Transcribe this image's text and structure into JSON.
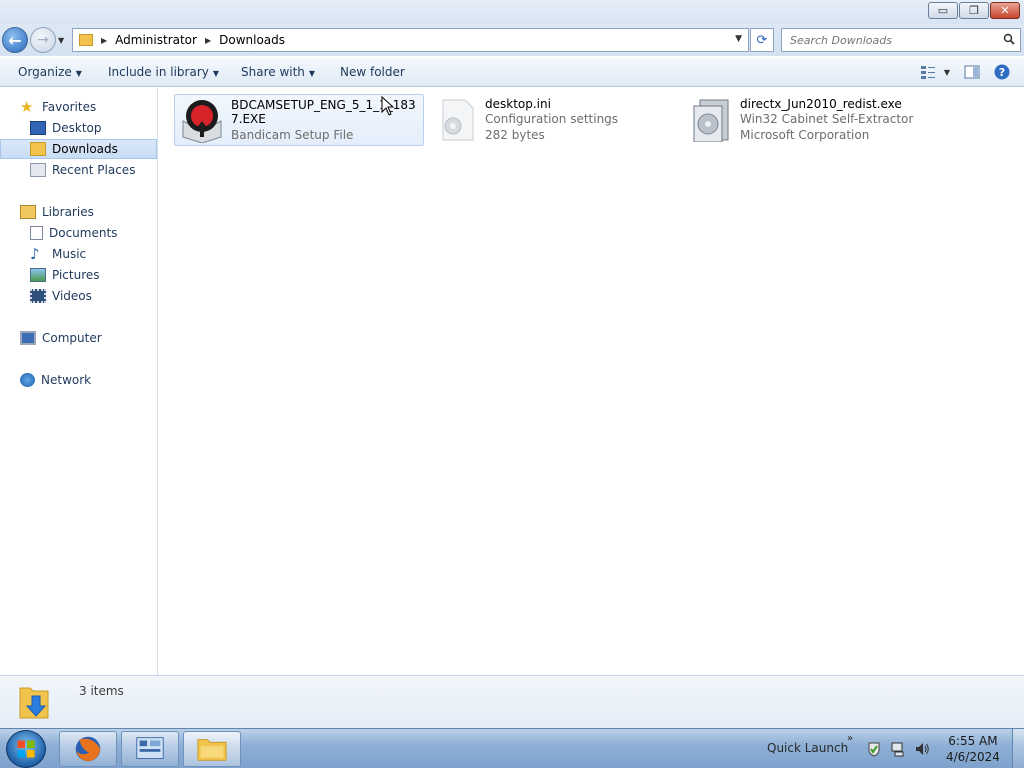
{
  "window": {
    "minimize_label": "▭",
    "maximize_label": "❐",
    "close_label": "✕"
  },
  "address": {
    "crumbs": [
      "Administrator",
      "Downloads"
    ],
    "search_placeholder": "Search Downloads"
  },
  "commandbar": {
    "organize": "Organize",
    "include_in_library": "Include in library",
    "share_with": "Share with",
    "new_folder": "New folder"
  },
  "navigation": {
    "favorites": "Favorites",
    "desktop": "Desktop",
    "downloads": "Downloads",
    "recent_places": "Recent Places",
    "libraries": "Libraries",
    "documents": "Documents",
    "music": "Music",
    "pictures": "Pictures",
    "videos": "Videos",
    "computer": "Computer",
    "network": "Network"
  },
  "files": [
    {
      "name": "BDCAMSETUP_ENG_5_1_1_1837.EXE",
      "type": "Bandicam Setup File",
      "detail": ""
    },
    {
      "name": "desktop.ini",
      "type": "Configuration settings",
      "detail": "282 bytes"
    },
    {
      "name": "directx_Jun2010_redist.exe",
      "type": "Win32 Cabinet Self-Extractor",
      "detail": "Microsoft Corporation"
    }
  ],
  "details_pane": {
    "item_count": "3 items"
  },
  "taskbar": {
    "quick_launch": "Quick Launch",
    "time": "6:55 AM",
    "date": "4/6/2024"
  },
  "colors": {
    "accent": "#1e395b",
    "selection": "#c9ddf5",
    "taskbar": "#8fb0d6"
  }
}
